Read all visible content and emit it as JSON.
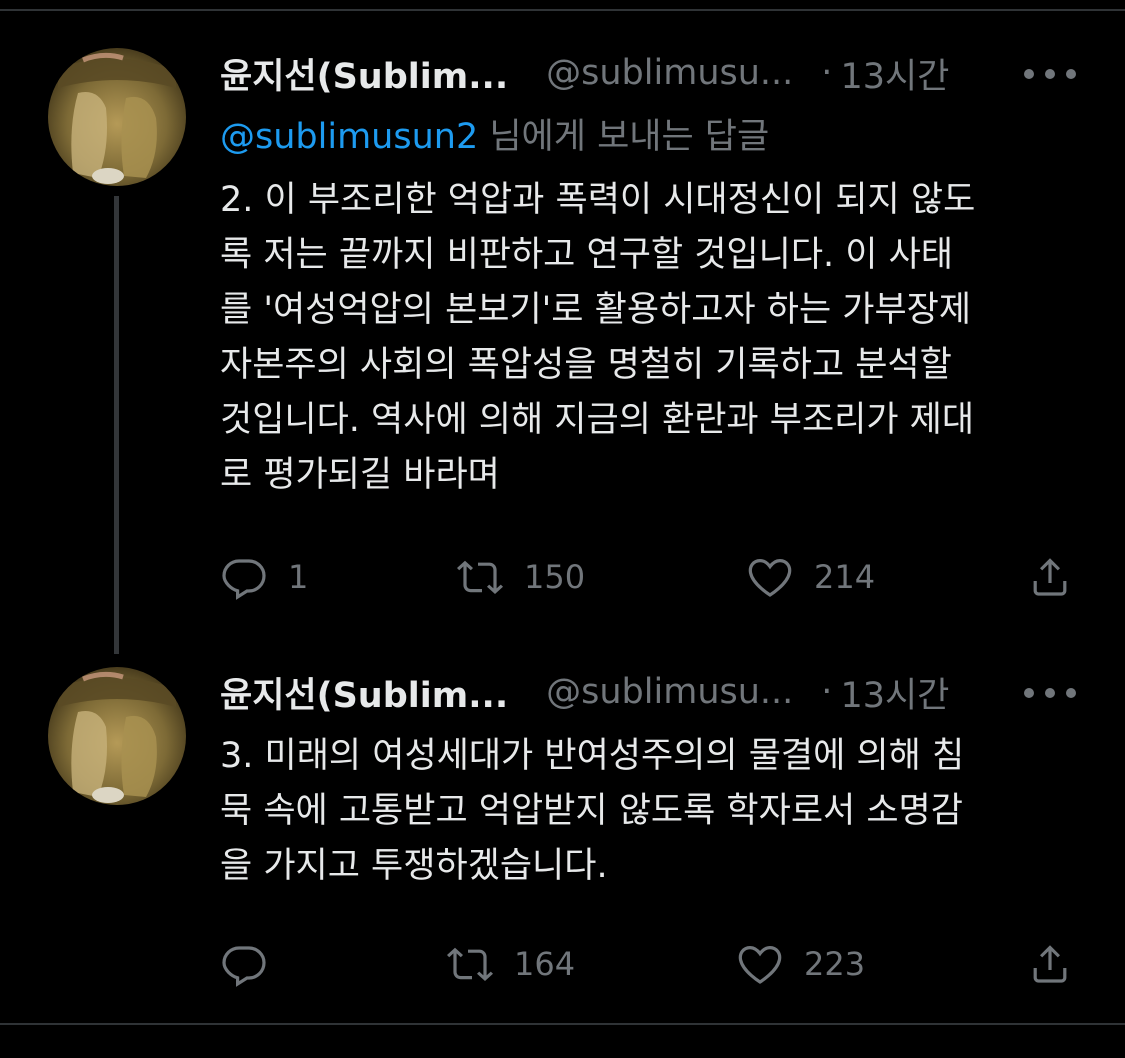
{
  "colors": {
    "background": "#000000",
    "text": "#e7e9ea",
    "secondary": "#71767b",
    "link": "#1d9bf0",
    "divider": "#2f3336"
  },
  "tweets": [
    {
      "display_name": "윤지선(Sublim...",
      "handle": "@sublimusu...",
      "dot": "·",
      "time": "13시간",
      "reply_prefix": "@sublimusun2",
      "reply_suffix": " 님에게 보내는 답글",
      "lines": [
        "2. 이 부조리한 억압과 폭력이 시대정신이 되지 않도",
        "록 저는 끝까지  비판하고 연구할 것입니다. 이 사태",
        "를 '여성억압의 본보기'로 활용하고자 하는 가부장제",
        "자본주의 사회의 폭압성을 명철히 기록하고 분석할",
        "것입니다. 역사에 의해 지금의 환란과 부조리가 제대",
        "로 평가되길 바라며"
      ],
      "replies": "1",
      "retweets": "150",
      "likes": "214",
      "icons": [
        "reply-icon",
        "retweet-icon",
        "like-icon",
        "share-icon",
        "more-icon"
      ]
    },
    {
      "display_name": "윤지선(Sublim...",
      "handle": "@sublimusu...",
      "dot": "·",
      "time": "13시간",
      "lines": [
        "3. 미래의 여성세대가 반여성주의의 물결에 의해 침",
        "묵 속에 고통받고 억압받지 않도록 학자로서 소명감",
        "을 가지고 투쟁하겠습니다."
      ],
      "replies": "",
      "retweets": "164",
      "likes": "223",
      "icons": [
        "reply-icon",
        "retweet-icon",
        "like-icon",
        "share-icon",
        "more-icon"
      ]
    }
  ]
}
